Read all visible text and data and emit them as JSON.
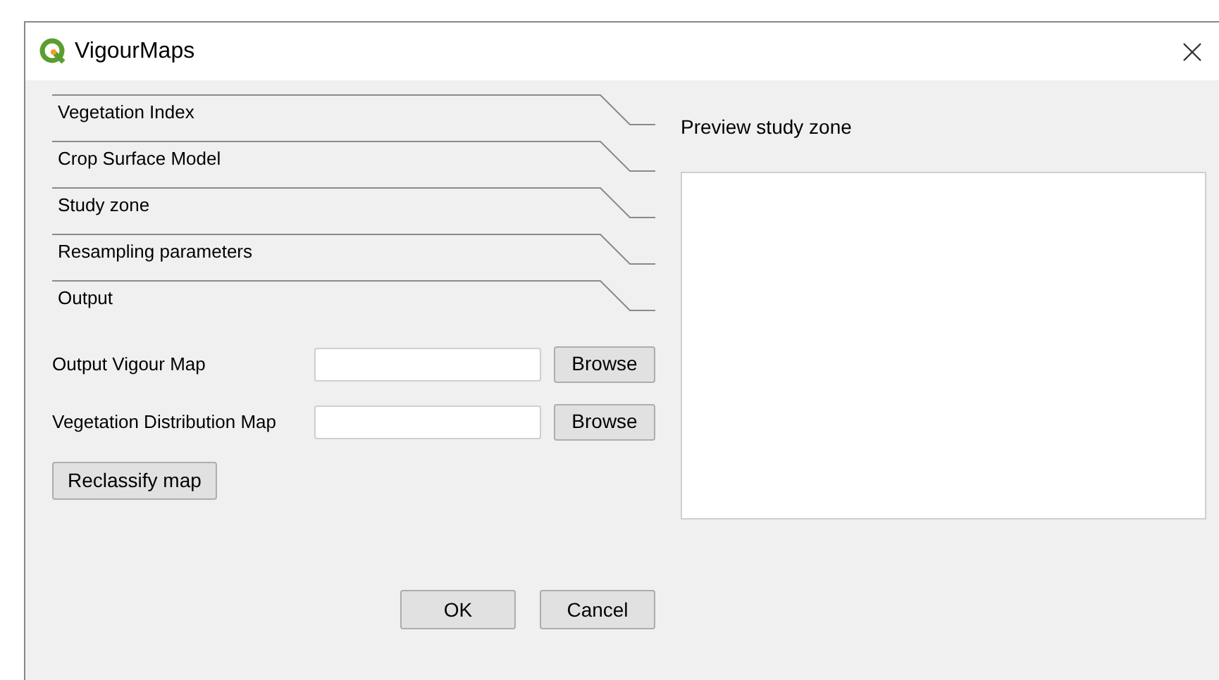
{
  "window": {
    "title": "VigourMaps"
  },
  "sections": [
    {
      "label": "Vegetation Index"
    },
    {
      "label": "Crop Surface Model"
    },
    {
      "label": "Study zone"
    },
    {
      "label": "Resampling parameters"
    },
    {
      "label": "Output"
    }
  ],
  "output_fields": [
    {
      "label": "Output Vigour Map",
      "button": "Browse"
    },
    {
      "label": "Vegetation Distribution Map",
      "button": "Browse"
    }
  ],
  "reclassify_button": "Reclassify map",
  "preview": {
    "label": "Preview study zone"
  },
  "buttons": [
    "OK",
    "Cancel"
  ]
}
